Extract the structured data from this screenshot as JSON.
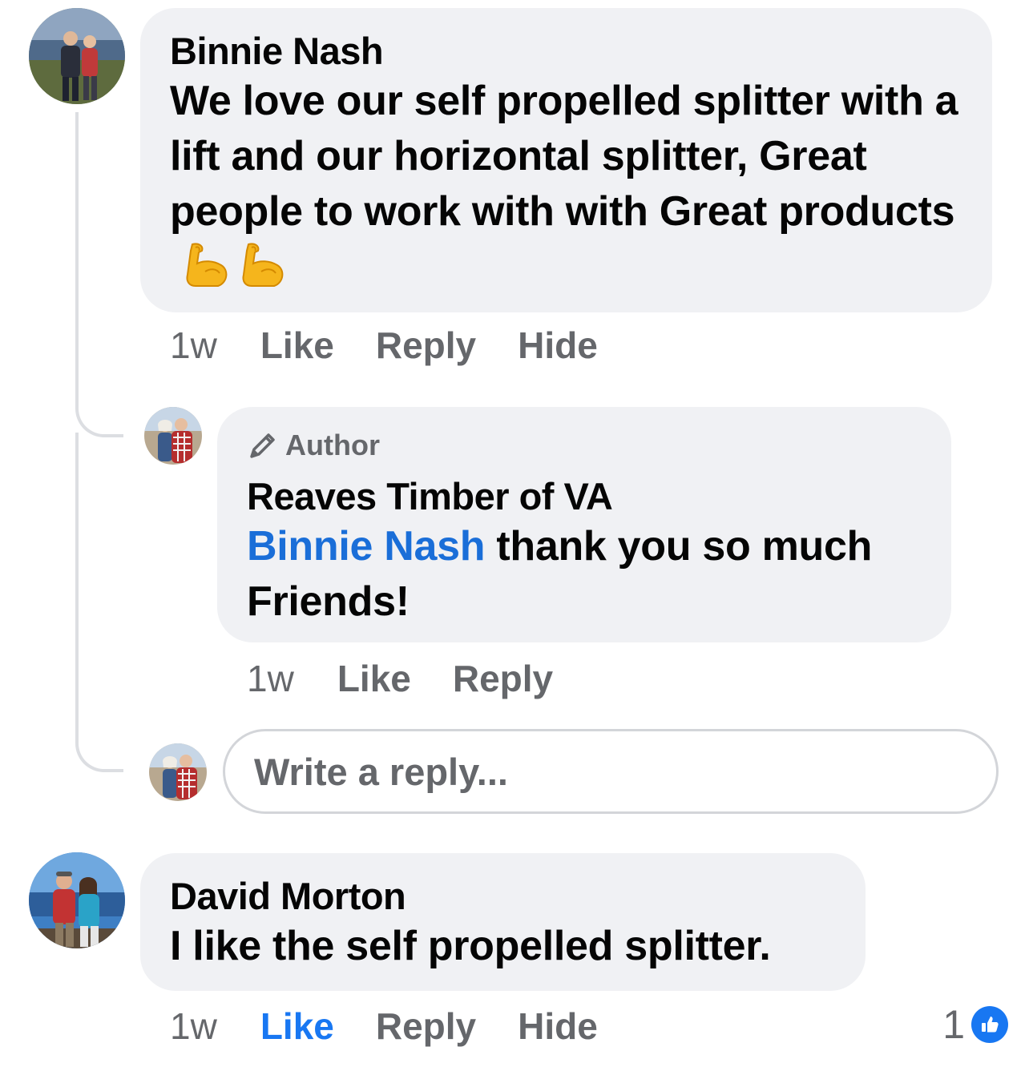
{
  "comments": [
    {
      "author": "Binnie Nash",
      "text": "We love our self propelled splitter with a lift and our horizontal splitter, Great people to work with with Great products",
      "emojis": [
        "flexed-biceps-emoji",
        "flexed-biceps-emoji"
      ],
      "time": "1w",
      "actions": {
        "like": "Like",
        "reply": "Reply",
        "hide": "Hide"
      }
    },
    {
      "badge": "Author",
      "author": "Reaves Timber of VA",
      "mention": "Binnie Nash",
      "text": " thank you so much Friends!",
      "time": "1w",
      "actions": {
        "like": "Like",
        "reply": "Reply"
      }
    },
    {
      "author": "David Morton",
      "text": "I like the self propelled splitter.",
      "time": "1w",
      "actions": {
        "like": "Like",
        "reply": "Reply",
        "hide": "Hide"
      },
      "liked": true,
      "reaction_count": "1"
    }
  ],
  "reply_box": {
    "placeholder": "Write a reply..."
  },
  "colors": {
    "bubble": "#f0f1f4",
    "secondary_text": "#65676b",
    "link_blue": "#1a6ed8",
    "like_blue": "#1877f2"
  }
}
